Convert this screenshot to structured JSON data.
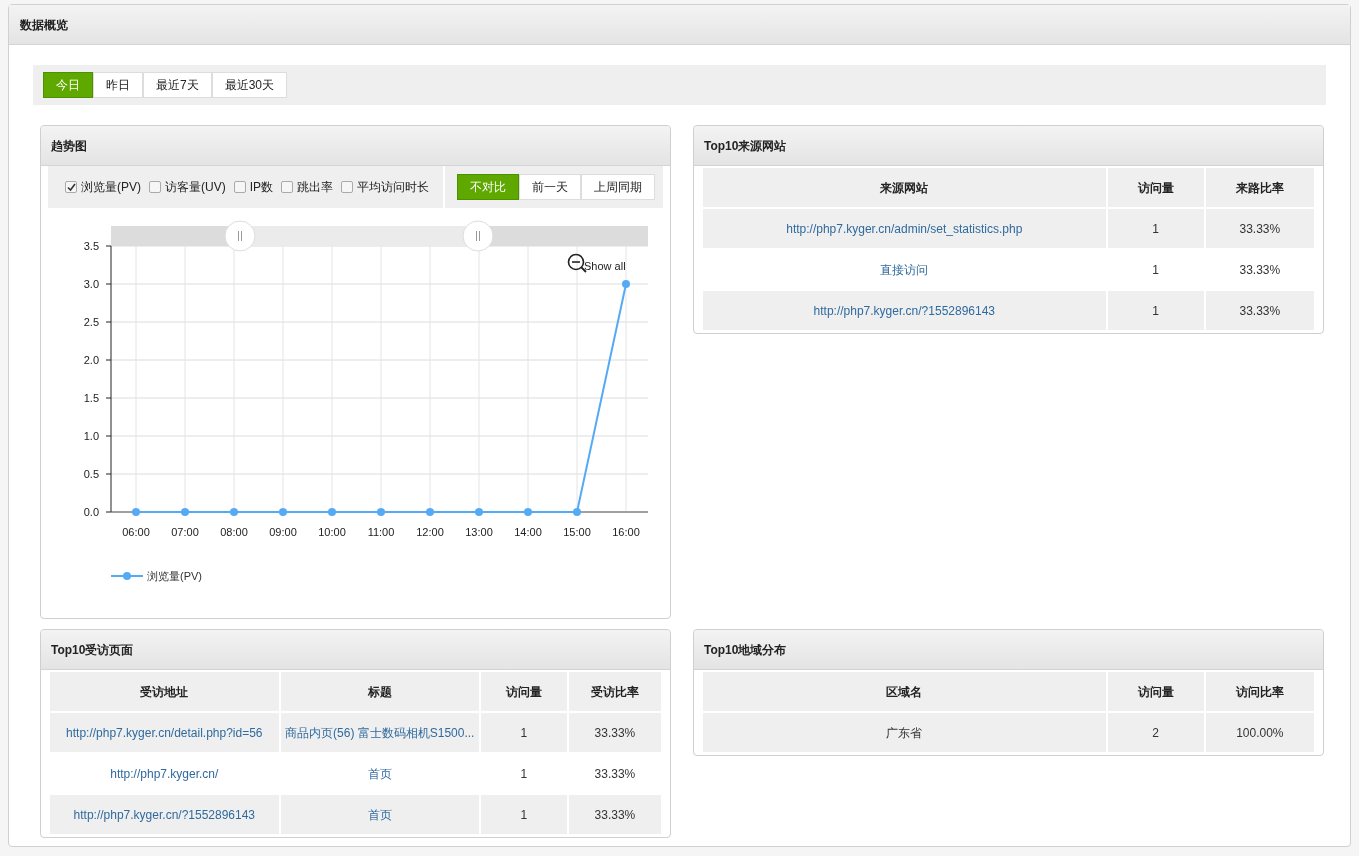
{
  "page": {
    "title": "数据概览"
  },
  "range_tabs": [
    {
      "label": "今日",
      "selected": true
    },
    {
      "label": "昨日",
      "selected": false
    },
    {
      "label": "最近7天",
      "selected": false
    },
    {
      "label": "最近30天",
      "selected": false
    }
  ],
  "trend": {
    "title": "趋势图",
    "metrics": [
      {
        "label": "浏览量(PV)",
        "checked": true
      },
      {
        "label": "访客量(UV)",
        "checked": false
      },
      {
        "label": "IP数",
        "checked": false
      },
      {
        "label": "跳出率",
        "checked": false
      },
      {
        "label": "平均访问时长",
        "checked": false
      }
    ],
    "compare_tabs": [
      {
        "label": "不对比",
        "selected": true
      },
      {
        "label": "前一天",
        "selected": false
      },
      {
        "label": "上周同期",
        "selected": false
      }
    ],
    "show_all": "Show all",
    "chart_data": {
      "type": "line",
      "categories": [
        "06:00",
        "07:00",
        "08:00",
        "09:00",
        "10:00",
        "11:00",
        "12:00",
        "13:00",
        "14:00",
        "15:00",
        "16:00"
      ],
      "series": [
        {
          "name": "浏览量(PV)",
          "color": "#55aaf5",
          "marker": true,
          "values": [
            0,
            0,
            0,
            0,
            0,
            0,
            0,
            0,
            0,
            0,
            3
          ]
        }
      ],
      "grid": true,
      "ylim": [
        0,
        3.5
      ],
      "yticks": [
        {
          "value": 0,
          "label": "0.0"
        },
        {
          "value": 0.5,
          "label": "0.5"
        },
        {
          "value": 1,
          "label": "1.0"
        },
        {
          "value": 1.5,
          "label": "1.5"
        },
        {
          "value": 2,
          "label": "2.0"
        },
        {
          "value": 2.5,
          "label": "2.5"
        },
        {
          "value": 3,
          "label": "3.0"
        },
        {
          "value": 3.5,
          "label": "3.5"
        }
      ]
    }
  },
  "sources": {
    "title": "Top10来源网站",
    "columns": [
      "来源网站",
      "访问量",
      "来路比率"
    ],
    "rows": [
      [
        "http://php7.kyger.cn/admin/set_statistics.php",
        "1",
        "33.33%"
      ],
      [
        "直接访问",
        "1",
        "33.33%"
      ],
      [
        "http://php7.kyger.cn/?1552896143",
        "1",
        "33.33%"
      ]
    ]
  },
  "pages": {
    "title": "Top10受访页面",
    "columns": [
      "受访地址",
      "标题",
      "访问量",
      "受访比率"
    ],
    "rows": [
      [
        "http://php7.kyger.cn/detail.php?id=56",
        "商品内页(56) 富士数码相机S1500...",
        "1",
        "33.33%"
      ],
      [
        "http://php7.kyger.cn/",
        "首页",
        "1",
        "33.33%"
      ],
      [
        "http://php7.kyger.cn/?1552896143",
        "首页",
        "1",
        "33.33%"
      ]
    ]
  },
  "regions": {
    "title": "Top10地域分布",
    "columns": [
      "区域名",
      "访问量",
      "访问比率"
    ],
    "rows": [
      [
        "广东省",
        "2",
        "100.00%"
      ]
    ]
  }
}
